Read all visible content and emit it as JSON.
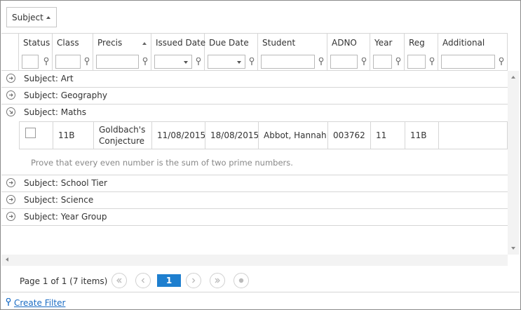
{
  "group_panel": {
    "chip_label": "Subject"
  },
  "columns": [
    {
      "label": "Status",
      "filter": "checkbox"
    },
    {
      "label": "Class",
      "filter": "text"
    },
    {
      "label": "Precis",
      "filter": "text"
    },
    {
      "label": "Issued Date",
      "filter": "select"
    },
    {
      "label": "Due Date",
      "filter": "select"
    },
    {
      "label": "Student",
      "filter": "text"
    },
    {
      "label": "ADNO",
      "filter": "text"
    },
    {
      "label": "Year",
      "filter": "text"
    },
    {
      "label": "Reg",
      "filter": "text"
    },
    {
      "label": "Additional",
      "filter": "text"
    }
  ],
  "group_label": "Subject",
  "groups": [
    {
      "value": "Art",
      "expanded": false
    },
    {
      "value": "Geography",
      "expanded": false
    },
    {
      "value": "Maths",
      "expanded": true
    },
    {
      "value": "School Tier",
      "expanded": false
    },
    {
      "value": "Science",
      "expanded": false
    },
    {
      "value": "Year Group",
      "expanded": false
    }
  ],
  "row": {
    "status_checked": false,
    "class": "11B",
    "precis_line1": "Goldbach's",
    "precis_line2": "Conjecture",
    "issued_date": "11/08/2015",
    "due_date": "18/08/2015",
    "student": "Abbot, Hannah",
    "adno": "003762",
    "year": "11",
    "reg": "11B",
    "additional": "",
    "description": "Prove that every even number is the sum of two prime numbers."
  },
  "pager": {
    "info": "Page 1 of 1 (7 items)",
    "current_page": "1"
  },
  "footer": {
    "create_filter": "Create Filter"
  },
  "colors": {
    "accent": "#1e7fcf",
    "link": "#1a6cc4",
    "border": "#d6d6d6"
  },
  "icons": {
    "group_collapsed": "circle-arrow-right-icon",
    "group_expanded": "circle-arrow-down-right-icon",
    "filter": "funnel-icon"
  }
}
